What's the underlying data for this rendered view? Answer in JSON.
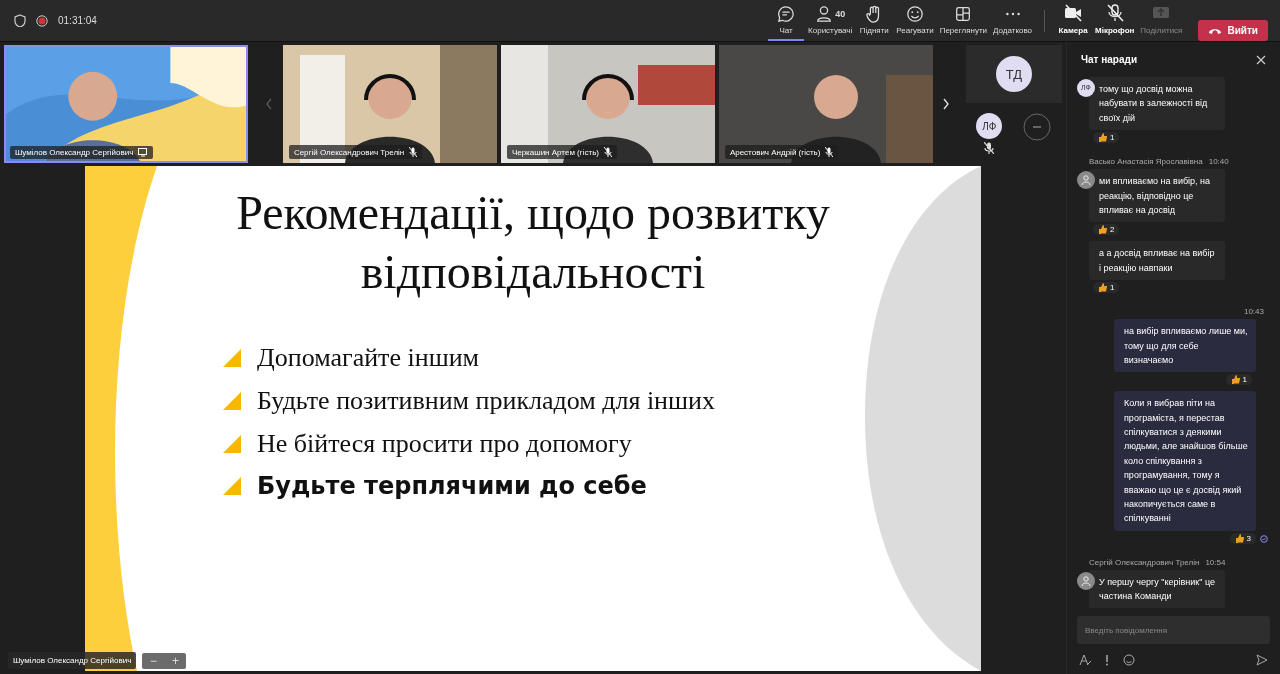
{
  "top_bar": {
    "timer": "01:31:04",
    "recording": true,
    "actions": [
      {
        "kind": "chat",
        "label": "Чат",
        "selected": true
      },
      {
        "kind": "people",
        "label": "Користувачі",
        "count": "40",
        "selected": false
      },
      {
        "kind": "hand",
        "label": "Підняти",
        "selected": false
      },
      {
        "kind": "react",
        "label": "Реагувати",
        "selected": false
      },
      {
        "kind": "view",
        "label": "Переглянути",
        "selected": false
      },
      {
        "kind": "more",
        "label": "Додатково",
        "selected": false
      }
    ],
    "devices": [
      {
        "kind": "camera",
        "label": "Камера",
        "on": false,
        "disabled": false
      },
      {
        "kind": "mic",
        "label": "Мікрофон",
        "on": false,
        "disabled": false
      },
      {
        "kind": "share",
        "label": "Поділитися",
        "disabled": true
      }
    ],
    "leave_button": "Вийти"
  },
  "video_strip": {
    "tiles": [
      {
        "name": "Шумілов Олександр Сергійович",
        "selected": true,
        "presenting": true,
        "muted": false,
        "kind": "picture"
      },
      {
        "name": "Сергій Олександрович Трелін",
        "selected": false,
        "presenting": false,
        "muted": true,
        "kind": "picture"
      },
      {
        "name": "Черкашин Артем (гість)",
        "selected": false,
        "presenting": false,
        "muted": true,
        "kind": "picture"
      },
      {
        "name": "Арестович Андрій (гість)",
        "selected": false,
        "presenting": false,
        "muted": true,
        "kind": "picture"
      }
    ],
    "roster": [
      {
        "initials": "ТД"
      },
      {
        "initials": "ЛФ",
        "muted": true
      }
    ]
  },
  "slide": {
    "title": "Рекомендації, щодо розвитку відповідальності",
    "bullets": [
      {
        "text": "Допомагайте іншим",
        "bold": false
      },
      {
        "text": "Будьте позитивним прикладом для інших",
        "bold": false
      },
      {
        "text": "Не бійтеся просити про допомогу",
        "bold": false
      },
      {
        "text": "Будьте терплячими до себе",
        "bold": true
      }
    ],
    "presenter": "Шумілов Олександр Сергійович",
    "zoom_controls": [
      "−",
      "+"
    ]
  },
  "chat": {
    "title": "Чат наради",
    "messages": [
      {
        "kind": "received",
        "avatar": {
          "kind": "initials",
          "text": "ЛФ"
        },
        "text": "тому що досвід можна набувати в залежності від своїх дій",
        "reaction": "1"
      },
      {
        "kind": "received",
        "sender": "Васько Анастасія Ярославівна",
        "time": "10:40",
        "avatar": {
          "kind": "person"
        },
        "text": "ми впливаємо на вибір, на реакцію, відповідно це впливає на досвід",
        "reaction": "2"
      },
      {
        "kind": "received",
        "text": "а а досвід впливає на вибір і реакцію навпаки",
        "reaction": "1"
      },
      {
        "kind": "sent",
        "time": "10:43",
        "text": "на вибір впливаємо лише ми, тому що для себе визначаємо",
        "reaction": "1"
      },
      {
        "kind": "sent",
        "text": "Коли я вибрав піти на програміста, я перестав спілкуватися з деякими людьми, але знайшов більше коло спілкування з програмування, тому я вважаю що це є досвід який накопичується саме в спілкуванні",
        "reaction": "3",
        "seen": true
      },
      {
        "kind": "received",
        "sender": "Сергій Олександрович Трелін",
        "time": "10:54",
        "avatar": {
          "kind": "person"
        },
        "text": "У першу чергу \"керівник\" це частина Команди"
      }
    ],
    "composer": {
      "placeholder": "Введіть повідомлення"
    }
  }
}
